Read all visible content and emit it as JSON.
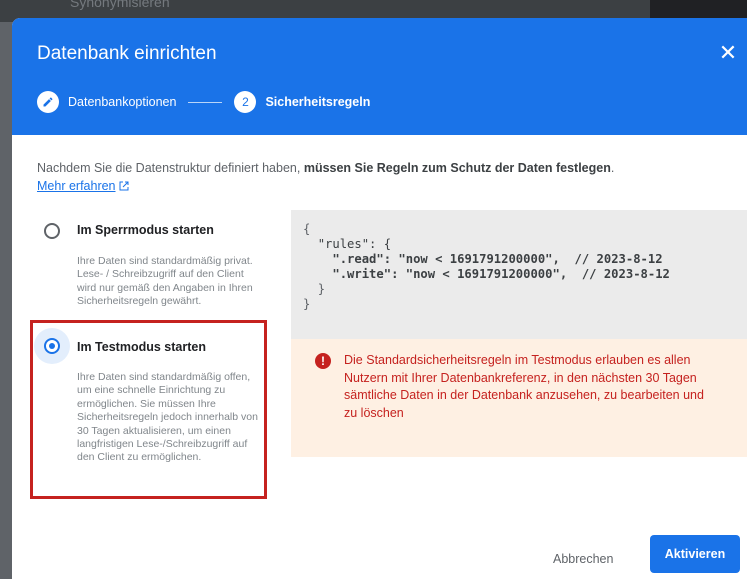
{
  "background": {
    "ghost_text": "Synonymisieren"
  },
  "dialog": {
    "title": "Datenbank einrichten",
    "close_icon": "close-icon",
    "steps": [
      {
        "label": "Datenbankoptionen",
        "marker": "edit-icon",
        "state": "done"
      },
      {
        "label": "Sicherheitsregeln",
        "marker": "2",
        "state": "active"
      }
    ],
    "intro_plain": "Nachdem Sie die Datenstruktur definiert haben, ",
    "intro_bold": "müssen Sie Regeln zum Schutz der Daten festlegen",
    "intro_end": ".",
    "learn_more": "Mehr erfahren",
    "options": [
      {
        "title": "Im Sperrmodus starten",
        "description": "Ihre Daten sind standardmäßig privat. Lese- / Schreibzugriff auf den Client wird nur gemäß den Angaben in Ihren Sicherheitsregeln gewährt.",
        "selected": false
      },
      {
        "title": "Im Testmodus starten",
        "description": "Ihre Daten sind standardmäßig offen, um eine schnelle Einrichtung zu ermöglichen. Sie müssen Ihre Sicherheitsregeln jedoch innerhalb von 30 Tagen aktualisieren, um einen langfristigen Lese-/Schreibzugriff auf den Client zu ermöglichen.",
        "selected": true
      }
    ],
    "code": {
      "open": "{",
      "rules_key": "\"rules\": {",
      "read_key": "\".read\"",
      "read_val": ": \"now < 1691791200000\",  // 2023-8-12",
      "write_key": "\".write\"",
      "write_val": ": \"now < 1691791200000\",  // 2023-8-12",
      "inner_close": "}",
      "close": "}"
    },
    "warning": {
      "icon": "!",
      "text": "Die Standardsicherheitsregeln im Testmodus erlauben es allen Nutzern mit Ihrer Datenbankreferenz, in den nächsten 30 Tagen sämtliche Daten in der Datenbank anzusehen, zu bearbeiten und zu löschen"
    },
    "buttons": {
      "cancel": "Abbrechen",
      "activate": "Aktivieren"
    }
  },
  "colors": {
    "header": "#1a73e8",
    "warning_bg": "#fef0e3",
    "warning_text": "#c5221f",
    "highlight_border": "#c5221f",
    "code_bg": "#ebebeb"
  }
}
